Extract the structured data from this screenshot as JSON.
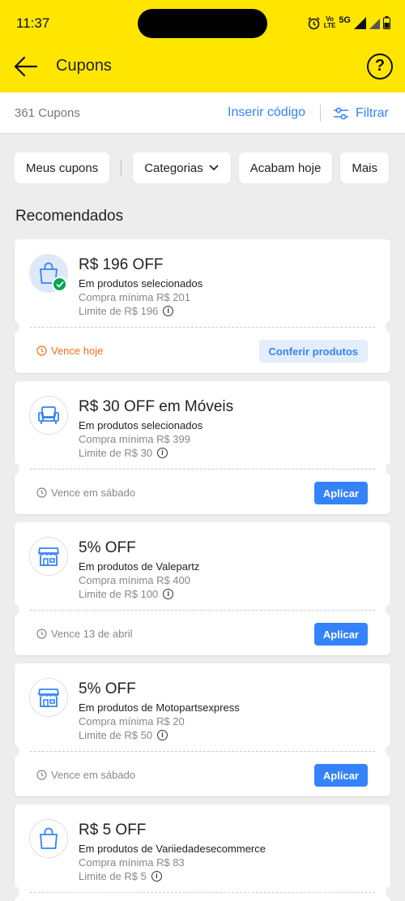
{
  "status": {
    "time": "11:37",
    "volte": "Vo\nLTE",
    "network": "5G"
  },
  "header": {
    "title": "Cupons",
    "help_label": "?"
  },
  "subbar": {
    "count": "361 Cupons",
    "insert_code": "Inserir código",
    "filter": "Filtrar"
  },
  "chips": [
    "Meus cupons",
    "Categorias",
    "Acabam hoje",
    "Mais"
  ],
  "section_title": "Recomendados",
  "coupons": [
    {
      "title": "R$ 196 OFF",
      "subtitle": "Em produtos selecionados",
      "min": "Compra mínima R$ 201",
      "limit": "Limite de R$ 196",
      "expiry": "Vence hoje",
      "action": "Conferir produtos",
      "icon": "shopping-bag-icon"
    },
    {
      "title": "R$ 30 OFF em Móveis",
      "subtitle": "Em produtos selecionados",
      "min": "Compra mínima R$ 399",
      "limit": "Limite de R$ 30",
      "expiry": "Vence em sábado",
      "action": "Aplicar",
      "icon": "armchair-icon"
    },
    {
      "title": "5% OFF",
      "subtitle": "Em produtos de Valepartz",
      "min": "Compra mínima R$ 400",
      "limit": "Limite de R$ 100",
      "expiry": "Vence 13 de abril",
      "action": "Aplicar",
      "icon": "store-icon"
    },
    {
      "title": "5% OFF",
      "subtitle": "Em produtos de Motopartsexpress",
      "min": "Compra mínima R$ 20",
      "limit": "Limite de R$ 50",
      "expiry": "Vence em sábado",
      "action": "Aplicar",
      "icon": "store-icon"
    },
    {
      "title": "R$ 5 OFF",
      "subtitle": "Em produtos de Variiedadesecommerce",
      "min": "Compra mínima R$ 83",
      "limit": "Limite de R$ 5",
      "icon": "shopping-bag-icon"
    }
  ],
  "colors": {
    "brand_yellow": "#ffe600",
    "accent_blue": "#3483fa",
    "warning_orange": "#f36d1c",
    "success_green": "#00a650"
  }
}
